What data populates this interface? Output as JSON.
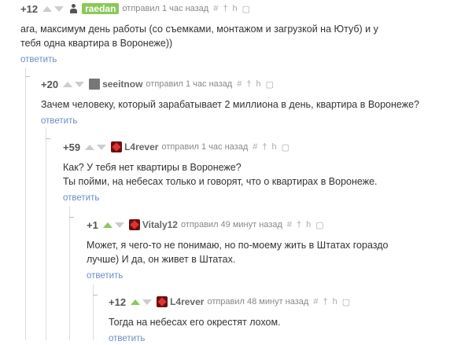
{
  "comments": [
    {
      "rating": "+12",
      "user": "raedan",
      "avatar": "person-avatar",
      "time": "отправил 1 час назад",
      "tools": [
        "#",
        "†",
        "h",
        "save"
      ],
      "text": "ага, максимум день работы (со съемками, монтажом и загрузкой на Ютуб) и у тебя одна квартира в Воронеже))",
      "reply": "ответить"
    },
    {
      "rating": "+20",
      "user": "seeitnow",
      "avatar": "gray-avatar",
      "time": "отправил 1 час назад",
      "tools": [
        "#",
        "†",
        "h",
        "save"
      ],
      "text": "Зачем человеку, который зарабатывает 2 миллиона в день, квартира в Воронеже?",
      "reply": "ответить"
    },
    {
      "rating": "+59",
      "user": "L4rever",
      "avatar": "red-avatar",
      "time": "отправил 1 час назад",
      "tools": [
        "#",
        "†",
        "h",
        "save"
      ],
      "text": "Как? У тебя нет квартиры в Воронеже?\nТы пойми, на небесах только и говорят, что о квартирах в Воронеже.",
      "reply": "ответить"
    },
    {
      "rating": "+1",
      "user": "Vitaly12",
      "avatar": "red-avatar",
      "time": "отправил 49 минут назад",
      "tools": [
        "#",
        "†",
        "h",
        "save"
      ],
      "text": "Может, я чего-то не понимаю, но по-моему жить в Штатах гораздо лучше) И да, он живет в Штатах.",
      "reply": "ответить"
    },
    {
      "rating": "+12",
      "user": "L4rever",
      "avatar": "red-avatar",
      "time": "отправил 48 минут назад",
      "tools": [
        "#",
        "†",
        "h",
        "save"
      ],
      "text": "Тогда на небесах его окрестят лохом.",
      "reply": "ответить"
    }
  ],
  "colors": {
    "upvote_active": "#8ac858",
    "link": "#6a8cc6",
    "badge": "#8ac858"
  }
}
